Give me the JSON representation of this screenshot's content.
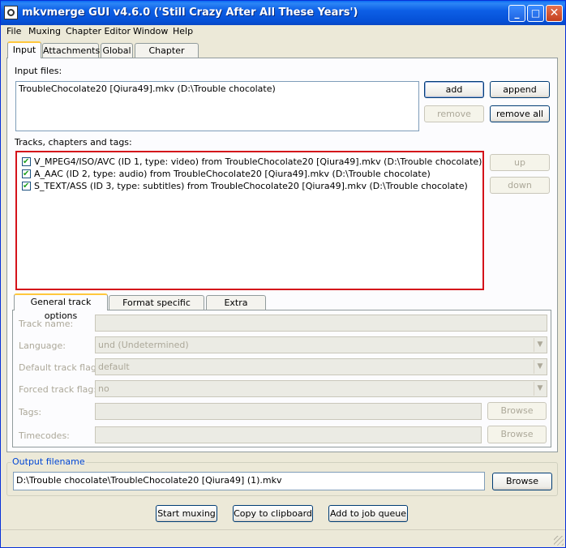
{
  "window": {
    "title": "mkvmerge GUI v4.6.0 ('Still Crazy After All These Years')",
    "controls": {
      "minimize": "_",
      "maximize": "□",
      "close": "✕"
    }
  },
  "menu": [
    "File",
    "Muxing",
    "Chapter Editor",
    "Window",
    "Help"
  ],
  "tabs": [
    "Input",
    "Attachments",
    "Global",
    "Chapter Editor"
  ],
  "input_files": {
    "label": "Input files:",
    "files": [
      "TroubleChocolate20 [Qiura49].mkv (D:\\Trouble chocolate)"
    ],
    "buttons": {
      "add": "add",
      "append": "append",
      "remove": "remove",
      "remove_all": "remove all"
    }
  },
  "tracks": {
    "label": "Tracks, chapters and tags:",
    "items": [
      "V_MPEG4/ISO/AVC (ID 1, type: video) from TroubleChocolate20 [Qiura49].mkv (D:\\Trouble chocolate)",
      "A_AAC (ID 2, type: audio) from TroubleChocolate20 [Qiura49].mkv (D:\\Trouble chocolate)",
      "S_TEXT/ASS (ID 3, type: subtitles) from TroubleChocolate20 [Qiura49].mkv (D:\\Trouble chocolate)"
    ],
    "buttons": {
      "up": "up",
      "down": "down"
    }
  },
  "track_options": {
    "tabs": [
      "General track options",
      "Format specific options",
      "Extra options"
    ],
    "track_name_label": "Track name:",
    "language_label": "Language:",
    "language_value": "und (Undetermined)",
    "default_flag_label": "Default track flag:",
    "default_flag_value": "default",
    "forced_flag_label": "Forced track flag:",
    "forced_flag_value": "no",
    "tags_label": "Tags:",
    "timecodes_label": "Timecodes:",
    "browse": "Browse"
  },
  "output": {
    "group_label": "Output filename",
    "value": "D:\\Trouble chocolate\\TroubleChocolate20 [Qiura49] (1).mkv",
    "browse": "Browse"
  },
  "actions": {
    "start": "Start muxing",
    "copy": "Copy to clipboard",
    "queue": "Add to job queue"
  },
  "colors": {
    "highlight_border": "#D4121A",
    "titlebar": "#0550D6",
    "group_title": "#0046D5"
  }
}
